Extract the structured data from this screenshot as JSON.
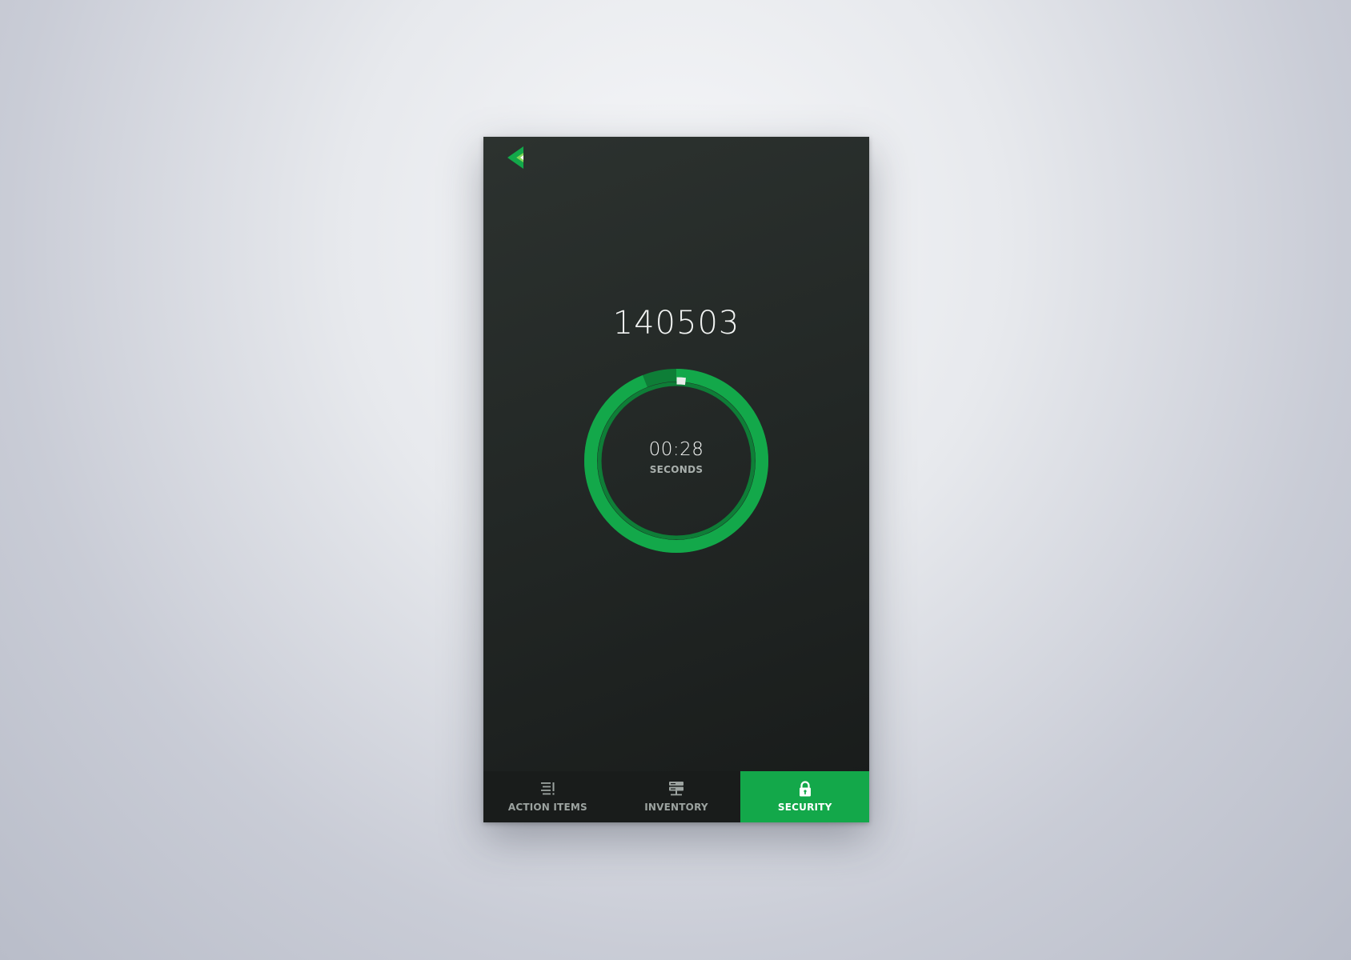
{
  "app": {
    "code": "140503"
  },
  "timer": {
    "value": "00:28",
    "unit": "SECONDS",
    "progress_fraction": 0.94,
    "ring_color": "#13a84a",
    "ring_dark_color": "#0e7e37",
    "remaining_marker_color": "#e9ecea"
  },
  "tabs": [
    {
      "label": "ACTION ITEMS",
      "icon": "action-items-icon",
      "active": false
    },
    {
      "label": "INVENTORY",
      "icon": "server-icon",
      "active": false
    },
    {
      "label": "SECURITY",
      "icon": "lock-icon",
      "active": true
    }
  ],
  "colors": {
    "accent": "#13a84a",
    "panel": "#232826",
    "tabbar": "#191c1b"
  }
}
